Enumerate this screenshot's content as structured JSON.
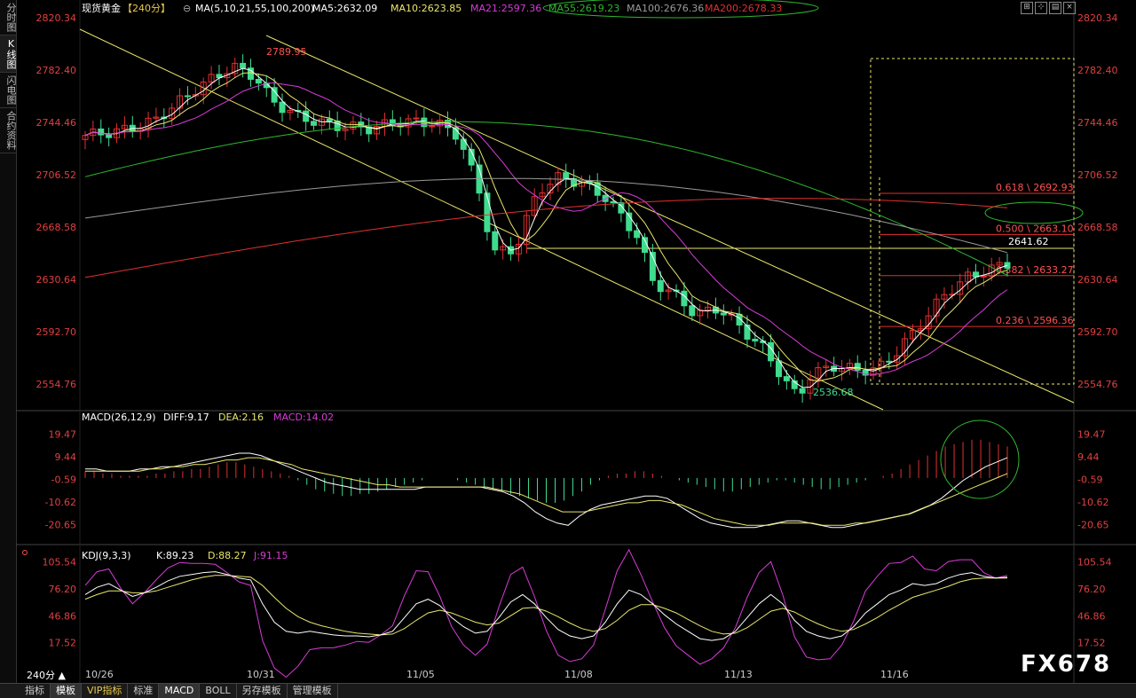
{
  "sidebar": {
    "tabs": [
      {
        "label": "分时图",
        "active": false
      },
      {
        "label": "K线图",
        "active": true
      },
      {
        "label": "闪电图",
        "active": false
      },
      {
        "label": "合约资料",
        "active": false
      }
    ]
  },
  "toolbar_icons": [
    "grid-icon",
    "crosshair-icon",
    "layout-icon",
    "close-icon"
  ],
  "header": {
    "symbol": "现货黄金",
    "period": "【240分】",
    "ma_label": "MA(5,10,21,55,100,200)",
    "ma5": "MA5:2632.09",
    "ma10": "MA10:2623.85",
    "ma21": "MA21:2597.36",
    "ma55": "MA55:2619.23",
    "ma100": "MA100:2676.36",
    "ma200": "MA200:2678.33"
  },
  "macd_header": {
    "label": "MACD(26,12,9)",
    "diff": "DIFF:9.17",
    "dea": "DEA:2.16",
    "macd": "MACD:14.02"
  },
  "kdj_header": {
    "label": "KDJ(9,3,3)",
    "k": "K:89.23",
    "d": "D:88.27",
    "j": "J:91.15"
  },
  "colors": {
    "ma5": "#ffffff",
    "ma10": "#e9e66b",
    "ma21": "#d63cd6",
    "ma55": "#2eb82e",
    "ma100": "#9a9a9a",
    "ma200": "#e03030",
    "up": "#e03030",
    "down": "#3fdc8e",
    "axis_text": "#e04040",
    "fib": "#e03030",
    "trend": "#e9e66b"
  },
  "bottombar": {
    "period": "240分 ▲",
    "tabs": [
      {
        "label": "指标",
        "active": false,
        "vip": false
      },
      {
        "label": "模板",
        "active": true,
        "vip": false
      },
      {
        "label": "VIP指标",
        "active": false,
        "vip": true
      },
      {
        "label": "标准",
        "active": false,
        "vip": false
      },
      {
        "label": "MACD",
        "active": true,
        "vip": false
      },
      {
        "label": "BOLL",
        "active": false,
        "vip": false
      },
      {
        "label": "另存模板",
        "active": false,
        "vip": false
      },
      {
        "label": "管理模板",
        "active": false,
        "vip": false
      }
    ]
  },
  "watermark": "FX678",
  "chart_data": {
    "type": "candlestick",
    "price_axis": {
      "ticks": [
        "2820.34",
        "2782.40",
        "2744.46",
        "2706.52",
        "2668.58",
        "2630.64",
        "2592.70",
        "2554.76"
      ],
      "range": [
        2536.0,
        2820.34
      ]
    },
    "x_labels": [
      "10/26",
      "10/31",
      "11/05",
      "11/08",
      "11/13",
      "11/16"
    ],
    "price_annotations": {
      "high": "2789.95",
      "low": "2536.68",
      "last": "2641.62"
    },
    "fibonacci": [
      {
        "label": "0.618 \\ 2692.93",
        "price": 2692.93
      },
      {
        "label": "0.500 \\ 2663.10",
        "price": 2663.1
      },
      {
        "label": "0.382 \\ 2633.27",
        "price": 2633.27
      },
      {
        "label": "0.236 \\ 2596.36",
        "price": 2596.36
      }
    ],
    "horizontal_support": 2641.62,
    "series_ma": [
      "MA5",
      "MA10",
      "MA21",
      "MA55",
      "MA100",
      "MA200"
    ],
    "macd_axis": {
      "ticks": [
        "19.47",
        "9.44",
        "-0.59",
        "-10.62",
        "-20.65"
      ],
      "range": [
        -26.0,
        24.0
      ]
    },
    "kdj_axis": {
      "ticks": [
        "105.54",
        "76.20",
        "46.86",
        "17.52"
      ],
      "range": [
        -5.0,
        112.0
      ]
    },
    "macd_hist": [
      3,
      3,
      2,
      2,
      1,
      1,
      1,
      1,
      2,
      2,
      3,
      3,
      4,
      4,
      5,
      6,
      7,
      7,
      6,
      5,
      4,
      3,
      2,
      1,
      -1,
      -3,
      -5,
      -6,
      -7,
      -8,
      -8,
      -7,
      -7,
      -6,
      -5,
      -4,
      -3,
      -2,
      -1,
      0,
      0,
      0,
      -1,
      -2,
      -3,
      -4,
      -5,
      -6,
      -7,
      -8,
      -9,
      -10,
      -11,
      -11,
      -10,
      -8,
      -6,
      -3,
      -1,
      1,
      2,
      2,
      3,
      3,
      2,
      1,
      0,
      -1,
      -2,
      -3,
      -4,
      -5,
      -6,
      -6,
      -5,
      -4,
      -3,
      -2,
      -1,
      -1,
      -2,
      -3,
      -4,
      -5,
      -5,
      -4,
      -3,
      -2,
      -1,
      0,
      1,
      2,
      4,
      6,
      8,
      10,
      12,
      14,
      15,
      16,
      17,
      17,
      16,
      15,
      14
    ],
    "macd_diff": [
      4,
      4,
      3,
      3,
      3,
      4,
      4,
      5,
      5,
      6,
      7,
      8,
      9,
      10,
      11,
      11,
      10,
      8,
      6,
      4,
      2,
      0,
      -2,
      -3,
      -4,
      -5,
      -5,
      -5,
      -5,
      -5,
      -5,
      -4,
      -4,
      -4,
      -4,
      -4,
      -4,
      -5,
      -6,
      -8,
      -11,
      -15,
      -18,
      -20,
      -21,
      -17,
      -14,
      -12,
      -11,
      -10,
      -9,
      -8,
      -8,
      -9,
      -12,
      -15,
      -18,
      -20,
      -21,
      -22,
      -22,
      -22,
      -21,
      -20,
      -19,
      -19,
      -20,
      -21,
      -22,
      -22,
      -21,
      -20,
      -19,
      -18,
      -17,
      -16,
      -14,
      -12,
      -9,
      -5,
      -1,
      2,
      5,
      7,
      9
    ],
    "macd_dea": [
      3,
      3,
      3,
      3,
      3,
      3,
      4,
      4,
      5,
      5,
      6,
      6,
      7,
      8,
      8,
      9,
      9,
      8,
      7,
      6,
      4,
      3,
      2,
      1,
      0,
      -1,
      -2,
      -3,
      -3,
      -4,
      -4,
      -4,
      -4,
      -4,
      -4,
      -4,
      -4,
      -4,
      -5,
      -6,
      -7,
      -9,
      -11,
      -13,
      -15,
      -15,
      -15,
      -14,
      -13,
      -12,
      -11,
      -11,
      -10,
      -10,
      -11,
      -12,
      -14,
      -16,
      -18,
      -19,
      -20,
      -21,
      -21,
      -21,
      -20,
      -20,
      -20,
      -20,
      -21,
      -21,
      -21,
      -20,
      -20,
      -19,
      -18,
      -17,
      -16,
      -14,
      -12,
      -10,
      -8,
      -6,
      -4,
      -2,
      0,
      2
    ],
    "kdj_k": [
      70,
      78,
      82,
      75,
      68,
      72,
      78,
      85,
      90,
      92,
      94,
      95,
      92,
      88,
      86,
      60,
      40,
      30,
      28,
      30,
      28,
      26,
      25,
      25,
      24,
      26,
      30,
      45,
      60,
      65,
      58,
      45,
      35,
      28,
      30,
      45,
      62,
      70,
      60,
      45,
      32,
      25,
      22,
      25,
      40,
      60,
      75,
      70,
      60,
      48,
      38,
      30,
      22,
      20,
      22,
      30,
      45,
      60,
      70,
      60,
      42,
      30,
      25,
      22,
      25,
      35,
      50,
      60,
      70,
      75,
      82,
      80,
      82,
      88,
      92,
      94,
      90,
      88,
      89
    ],
    "kdj_d": [
      65,
      70,
      74,
      74,
      72,
      72,
      74,
      78,
      82,
      86,
      89,
      91,
      91,
      90,
      89,
      80,
      67,
      55,
      46,
      40,
      36,
      33,
      30,
      28,
      27,
      26,
      27,
      33,
      42,
      50,
      53,
      50,
      45,
      40,
      37,
      39,
      47,
      55,
      56,
      52,
      46,
      39,
      33,
      30,
      33,
      42,
      53,
      59,
      59,
      55,
      50,
      43,
      36,
      30,
      27,
      28,
      34,
      43,
      52,
      55,
      51,
      44,
      38,
      33,
      30,
      32,
      38,
      45,
      53,
      60,
      67,
      71,
      75,
      79,
      84,
      87,
      88,
      88,
      88
    ],
    "kdj_j": [
      80,
      95,
      98,
      77,
      60,
      72,
      86,
      99,
      105,
      104,
      104,
      103,
      94,
      84,
      80,
      20,
      -10,
      -20,
      -8,
      10,
      12,
      12,
      15,
      19,
      18,
      26,
      36,
      69,
      96,
      95,
      68,
      35,
      15,
      4,
      16,
      57,
      92,
      100,
      68,
      31,
      4,
      -3,
      0,
      15,
      54,
      96,
      119,
      92,
      62,
      34,
      14,
      4,
      -6,
      0,
      12,
      34,
      67,
      94,
      106,
      70,
      24,
      2,
      -1,
      0,
      15,
      41,
      74,
      90,
      104,
      105,
      112,
      98,
      96,
      106,
      108,
      108,
      94,
      88,
      91
    ]
  }
}
